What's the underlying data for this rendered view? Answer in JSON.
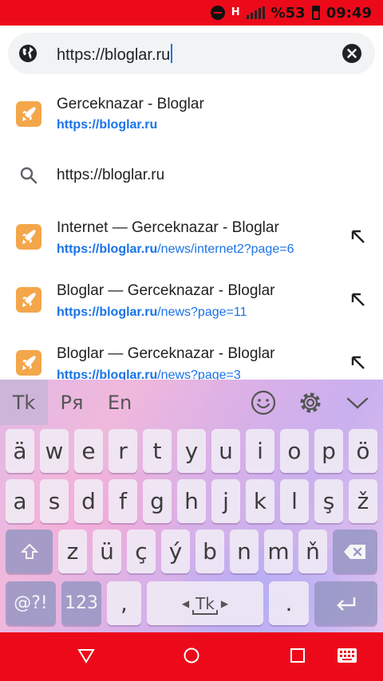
{
  "status_bar": {
    "network": "H",
    "battery": "%53",
    "time": "09:49"
  },
  "omnibox": {
    "url": "https://bloglar.ru"
  },
  "suggestions": [
    {
      "type": "bookmark",
      "title": "Gerceknazar - Bloglar",
      "url_bold": "https://bloglar.ru",
      "url_rest": ""
    },
    {
      "type": "search",
      "title": "https://bloglar.ru"
    },
    {
      "type": "history",
      "title": "Internet — Gerceknazar - Bloglar",
      "url_bold": "https://bloglar.ru",
      "url_rest": "/news/internet2?page=6"
    },
    {
      "type": "history",
      "title": "Bloglar — Gerceknazar - Bloglar",
      "url_bold": "https://bloglar.ru",
      "url_rest": "/news?page=11"
    },
    {
      "type": "history",
      "title": "Bloglar — Gerceknazar - Bloglar",
      "url_bold": "https://bloglar.ru",
      "url_rest": "/news?page=3"
    }
  ],
  "keyboard": {
    "languages": [
      "Tk",
      "Ря",
      "En"
    ],
    "row1": [
      "ä",
      "w",
      "e",
      "r",
      "t",
      "y",
      "u",
      "i",
      "o",
      "p",
      "ö"
    ],
    "row2": [
      "a",
      "s",
      "d",
      "f",
      "g",
      "h",
      "j",
      "k",
      "l",
      "ş",
      "ž"
    ],
    "row3": [
      "z",
      "ü",
      "ç",
      "ý",
      "b",
      "n",
      "m",
      "ň"
    ],
    "symbols_label": "@?!",
    "numbers_label": "123",
    "comma_label": ",",
    "space_label": "Tk",
    "period_label": "."
  },
  "colors": {
    "accent_red": "#ec0a1a",
    "link_blue": "#1a73e8",
    "bookmark_orange": "#f4a64b"
  }
}
